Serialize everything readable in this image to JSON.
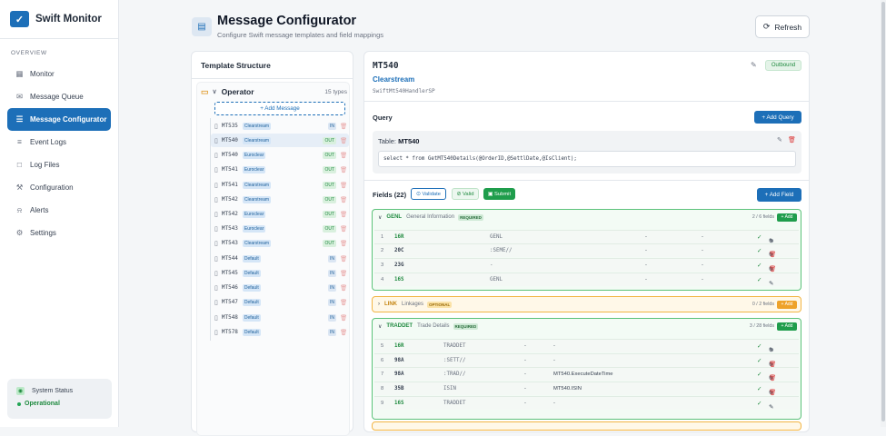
{
  "app": {
    "name": "Swift Monitor",
    "logo_glyph": "✓"
  },
  "sidebar": {
    "section": "OVERVIEW",
    "items": [
      {
        "label": "Monitor",
        "icon": "grid-icon",
        "glyph": "▦"
      },
      {
        "label": "Message Queue",
        "icon": "inbox-icon",
        "glyph": "✉"
      },
      {
        "label": "Message Configurator",
        "icon": "document-icon",
        "glyph": "☰",
        "active": true
      },
      {
        "label": "Event Logs",
        "icon": "list-icon",
        "glyph": "≡"
      },
      {
        "label": "Log Files",
        "icon": "folder-icon",
        "glyph": "□"
      },
      {
        "label": "Configuration",
        "icon": "wrench-icon",
        "glyph": "⚒"
      },
      {
        "label": "Alerts",
        "icon": "bell-icon",
        "glyph": "⍾"
      },
      {
        "label": "Settings",
        "icon": "gear-icon",
        "glyph": "⚙"
      }
    ],
    "status": {
      "title": "System Status",
      "value": "Operational"
    }
  },
  "header": {
    "title": "Message Configurator",
    "subtitle": "Configure Swift message templates and field mappings",
    "refresh": "Refresh"
  },
  "template": {
    "title": "Template Structure",
    "operator": {
      "label": "Operator",
      "count": "15 types"
    },
    "add_message": "+ Add Message",
    "messages": [
      {
        "name": "MT535",
        "tag": "Clearstream",
        "dir": "IN"
      },
      {
        "name": "MT540",
        "tag": "Clearstream",
        "dir": "OUT",
        "selected": true
      },
      {
        "name": "MT540",
        "tag": "Euroclear",
        "dir": "OUT"
      },
      {
        "name": "MT541",
        "tag": "Euroclear",
        "dir": "OUT"
      },
      {
        "name": "MT541",
        "tag": "Clearstream",
        "dir": "OUT"
      },
      {
        "name": "MT542",
        "tag": "Clearstream",
        "dir": "OUT"
      },
      {
        "name": "MT542",
        "tag": "Euroclear",
        "dir": "OUT"
      },
      {
        "name": "MT543",
        "tag": "Euroclear",
        "dir": "OUT"
      },
      {
        "name": "MT543",
        "tag": "Clearstream",
        "dir": "OUT"
      },
      {
        "name": "MT544",
        "tag": "Default",
        "dir": "IN"
      },
      {
        "name": "MT545",
        "tag": "Default",
        "dir": "IN"
      },
      {
        "name": "MT546",
        "tag": "Default",
        "dir": "IN"
      },
      {
        "name": "MT547",
        "tag": "Default",
        "dir": "IN"
      },
      {
        "name": "MT548",
        "tag": "Default",
        "dir": "IN"
      },
      {
        "name": "MT578",
        "tag": "Default",
        "dir": "IN"
      }
    ]
  },
  "detail": {
    "mt": "MT540",
    "provider": "Clearstream",
    "handler": "SwiftMt540HandlerSP",
    "direction": "Outbound",
    "query": {
      "title": "Query",
      "add": "+ Add Query",
      "table_label": "Table:",
      "table": "MT540",
      "sql": "select * from GetMT540Details(@OrderID,@SettlDate,@IsClient);"
    },
    "fields": {
      "title": "Fields (22)",
      "validate": "Validate",
      "valid": "Valid",
      "submit": "Submit",
      "add": "+ Add Field"
    },
    "groups": [
      {
        "code": "GENL",
        "desc": "General Information",
        "badge": "REQUIRED",
        "count": "2 / 6 fields",
        "add": "+ Add",
        "rows": [
          {
            "no": "1",
            "tag": "16R",
            "qual": "GENL",
            "a": "-",
            "b": "-",
            "tag_style": "g",
            "acts": "✎⊕"
          },
          {
            "no": "2",
            "tag": "20C",
            "qual": ":SEME//",
            "a": "-",
            "b": "-",
            "tag_style": "d",
            "acts": "✎⊕🗑"
          },
          {
            "no": "3",
            "tag": "23G",
            "qual": "-",
            "a": "-",
            "b": "-",
            "tag_style": "d",
            "acts": "✎⊕🗑"
          },
          {
            "no": "4",
            "tag": "16S",
            "qual": "GENL",
            "a": "-",
            "b": "-",
            "tag_style": "g",
            "acts": "✎"
          }
        ]
      },
      {
        "code": "LINK",
        "desc": "Linkages",
        "badge": "OPTIONAL",
        "count": "0 / 2 fields",
        "add": "+ Add"
      },
      {
        "code": "TRADDET",
        "desc": "Trade Details",
        "badge": "REQUIRED",
        "count": "3 / 28 fields",
        "add": "+ Add",
        "rows": [
          {
            "no": "5",
            "tag": "16R",
            "qual": "TRADDET",
            "a": "-",
            "b": "-",
            "tag_style": "g",
            "acts": "✎⊕"
          },
          {
            "no": "6",
            "tag": "98A",
            "qual": ":SETT//",
            "a": "-",
            "b": "-",
            "tag_style": "d",
            "acts": "✎⊕🗑"
          },
          {
            "no": "7",
            "tag": "98A",
            "qual": ":TRAD//",
            "a": "-",
            "b": "MT540.ExecuteDateTime",
            "tag_style": "d",
            "acts": "✎⊕🗑"
          },
          {
            "no": "8",
            "tag": "35B",
            "qual": "ISIN",
            "a": "-",
            "b": "MT540.ISIN",
            "tag_style": "d",
            "acts": "✎⊕🗑"
          },
          {
            "no": "9",
            "tag": "16S",
            "qual": "TRADDET",
            "a": "-",
            "b": "-",
            "tag_style": "g",
            "acts": "✎"
          }
        ]
      }
    ]
  }
}
